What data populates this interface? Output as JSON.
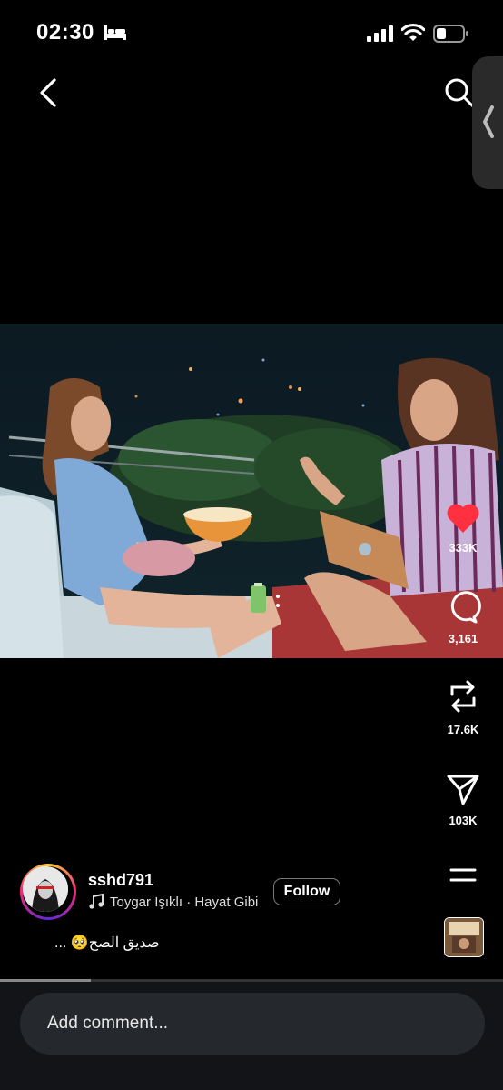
{
  "status_bar": {
    "time": "02:30"
  },
  "post": {
    "username": "sshd791",
    "music": "Toygar Işıklı · Hayat Gibi",
    "follow_label": "Follow",
    "caption": "صديق الصح🥺 ...",
    "progress": 0.18
  },
  "actions": {
    "likes": "333K",
    "comments": "3,161",
    "reposts": "17.6K",
    "shares": "103K"
  },
  "comment_box": {
    "placeholder": "Add comment..."
  },
  "colors": {
    "like": "#ff3040",
    "background": "#000000"
  }
}
